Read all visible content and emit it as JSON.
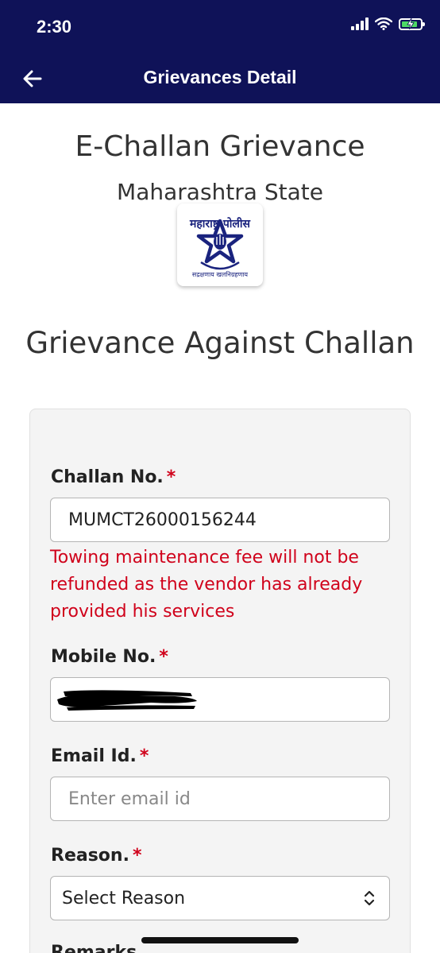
{
  "status_bar": {
    "time": "2:30"
  },
  "nav": {
    "title": "Grievances Detail",
    "back_icon": "arrow-left-icon"
  },
  "header": {
    "title": "E-Challan Grievance",
    "subtitle": "Maharashtra State",
    "logo_text_top": "महाराष्ट्र पोलीस",
    "logo_text_bottom": "सद्रक्षणाय खलनिग्रहणाय"
  },
  "form": {
    "title": "Grievance Against Challan",
    "required_marker": "*",
    "challan": {
      "label": "Challan No.",
      "value": "MUMCT26000156244"
    },
    "warning": "Towing maintenance fee will not be refunded as the vendor has already provided his services",
    "mobile": {
      "label": "Mobile No.",
      "value": ""
    },
    "email": {
      "label": "Email Id.",
      "placeholder": "Enter email id"
    },
    "reason": {
      "label": "Reason.",
      "selected": "Select Reason"
    },
    "remarks": {
      "label": "Remarks"
    }
  },
  "colors": {
    "nav_bg": "#0f1258",
    "required": "#d0021b",
    "card_bg": "#f4f4f4",
    "battery": "#4cd964"
  }
}
